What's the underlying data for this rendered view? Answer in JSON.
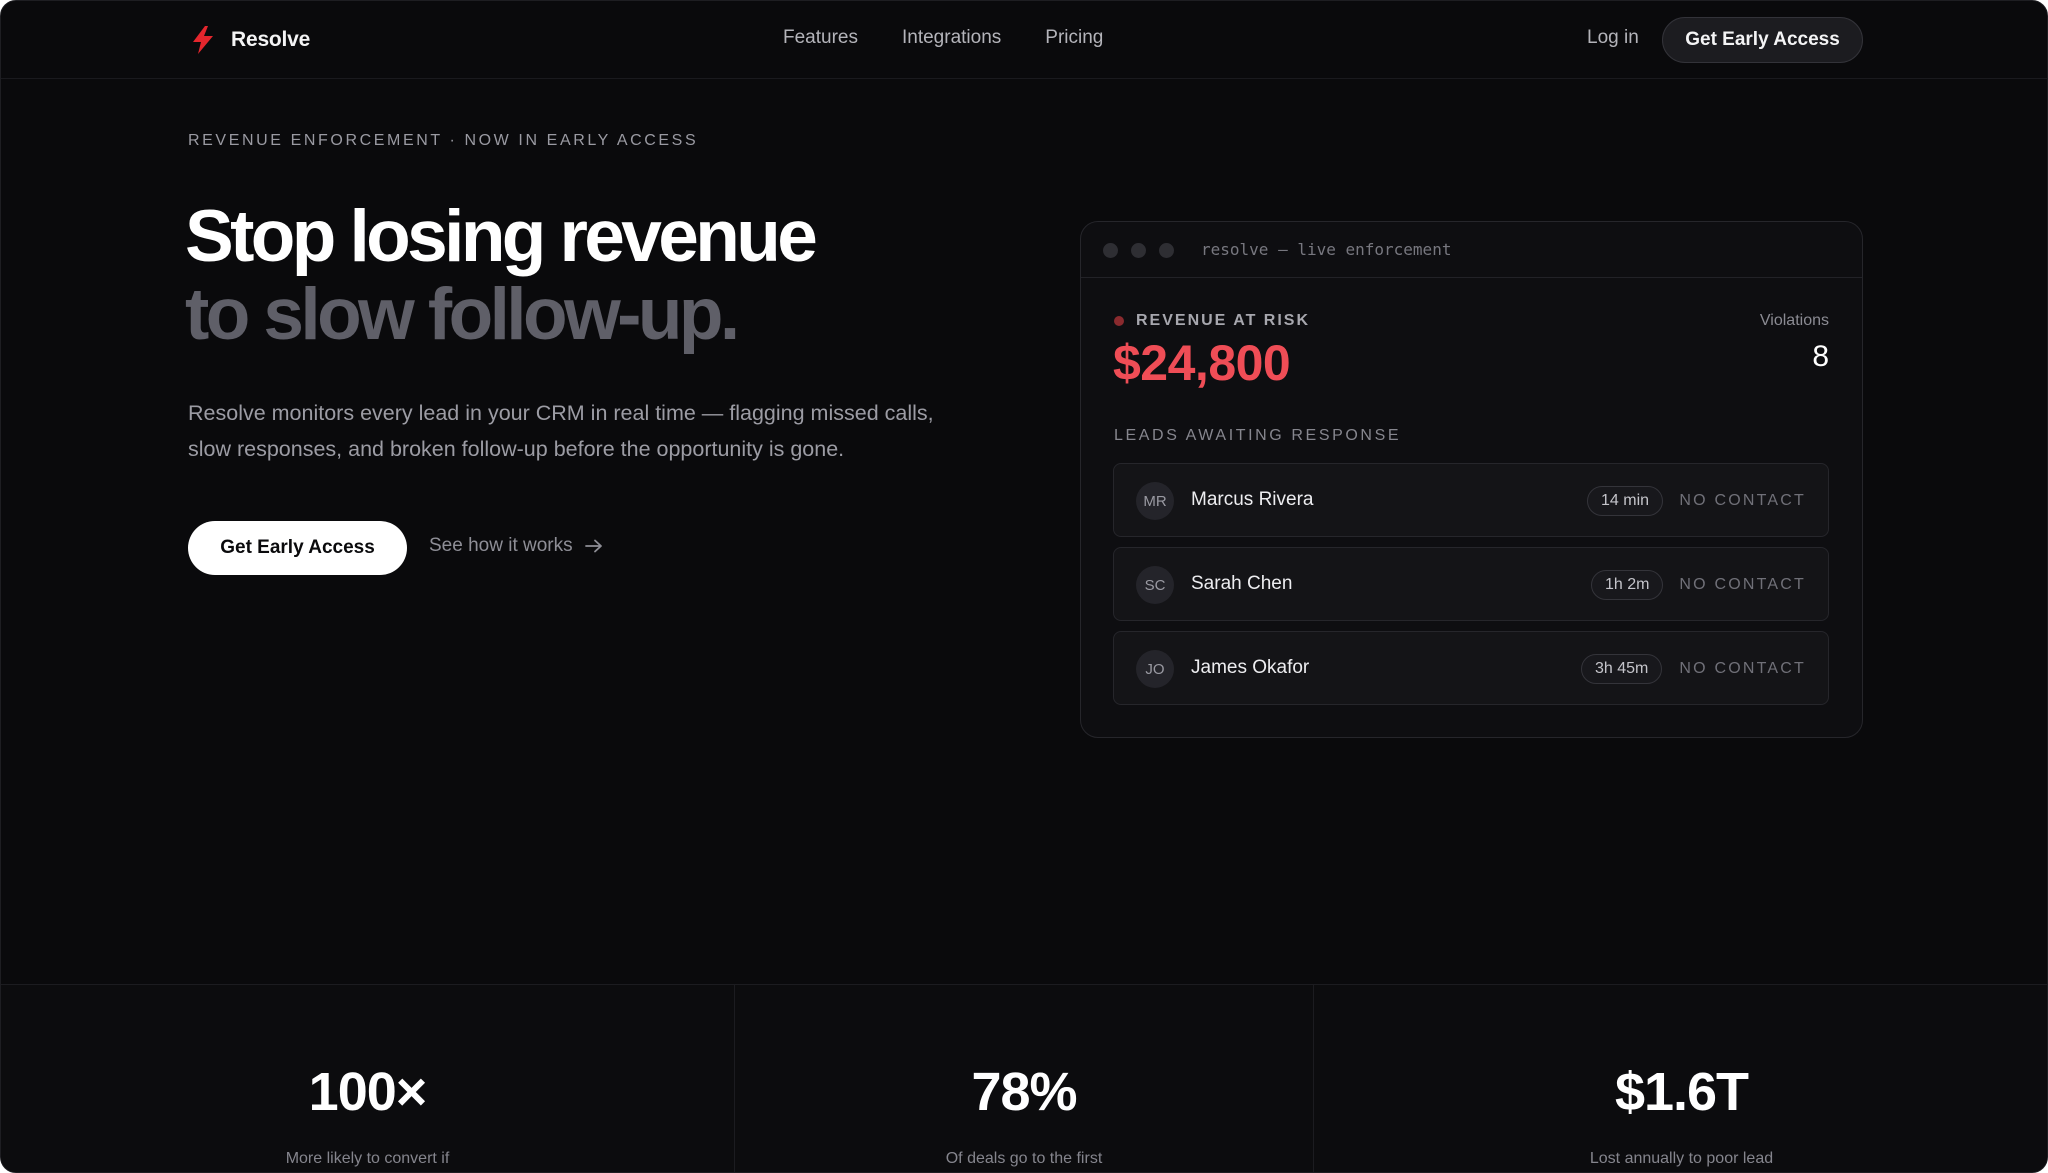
{
  "nav": {
    "brand": "Resolve",
    "links": [
      "Features",
      "Integrations",
      "Pricing"
    ],
    "login": "Log in",
    "cta": "Get Early Access"
  },
  "hero": {
    "eyebrow": "REVENUE ENFORCEMENT · NOW IN EARLY ACCESS",
    "headline_line1": "Stop losing revenue",
    "headline_line2": "to slow follow-up.",
    "lede": "Resolve monitors every lead in your CRM in real time — flagging missed calls, slow responses, and broken follow-up before the opportunity is gone.",
    "cta_primary": "Get Early Access",
    "cta_secondary": "See how it works"
  },
  "console": {
    "title": "resolve — live enforcement",
    "risk_label": "REVENUE AT RISK",
    "risk_amount": "$24,800",
    "violations_label": "Violations",
    "violations_count": "8",
    "leads_heading": "LEADS AWAITING RESPONSE",
    "leads": [
      {
        "initials": "MR",
        "name": "Marcus Rivera",
        "time": "14 min",
        "status": "NO CONTACT"
      },
      {
        "initials": "SC",
        "name": "Sarah Chen",
        "time": "1h 2m",
        "status": "NO CONTACT"
      },
      {
        "initials": "JO",
        "name": "James Okafor",
        "time": "3h 45m",
        "status": "NO CONTACT"
      }
    ]
  },
  "stats": [
    {
      "value": "100×",
      "caption": "More likely to convert if"
    },
    {
      "value": "78%",
      "caption": "Of deals go to the first"
    },
    {
      "value": "$1.6T",
      "caption": "Lost annually to poor lead"
    }
  ],
  "colors": {
    "background": "#0a0a0c",
    "accent_red": "#ef4d56",
    "logo_red": "#e5262d"
  },
  "icons": {
    "brand": "lightning-bolt-icon",
    "secondary_cta": "arrow-right-icon"
  }
}
